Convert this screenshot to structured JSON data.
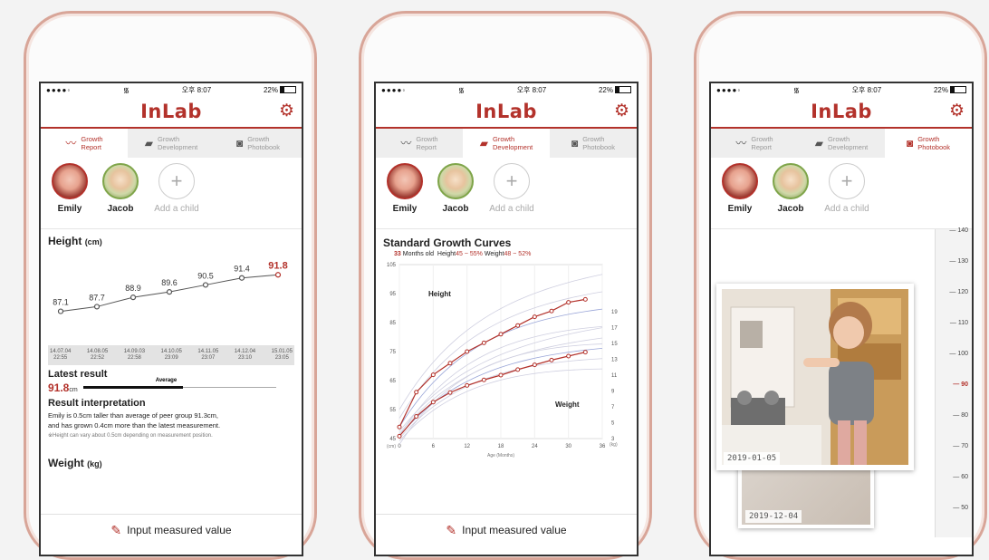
{
  "status": {
    "signal": "●●●●◦",
    "wifi": "wifi-icon",
    "time": "오후 8:07",
    "battery": "22%"
  },
  "app": {
    "logo": "InLab",
    "settings_icon": "gear-icon"
  },
  "tabs": [
    {
      "label1": "Growth",
      "label2": "Report",
      "icon": "trend-icon"
    },
    {
      "label1": "Growth",
      "label2": "Development",
      "icon": "chart-icon"
    },
    {
      "label1": "Growth",
      "label2": "Photobook",
      "icon": "camera-icon"
    }
  ],
  "children": [
    {
      "name": "Emily"
    },
    {
      "name": "Jacob"
    }
  ],
  "add_child": "Add a child",
  "input_button": "Input measured value",
  "report": {
    "height_title": "Height",
    "height_unit": "(cm)",
    "height_values": [
      87.1,
      87.7,
      88.9,
      89.6,
      90.5,
      91.4,
      91.8
    ],
    "height_labels": [
      "87.1",
      "87.7",
      "88.9",
      "89.6",
      "90.5",
      "91.4",
      "91.8"
    ],
    "dates": [
      {
        "d": "14.07.04",
        "t": "22:55"
      },
      {
        "d": "14.08.05",
        "t": "22:52"
      },
      {
        "d": "14.09.03",
        "t": "22:58"
      },
      {
        "d": "14.10.05",
        "t": "23:09"
      },
      {
        "d": "14.11.05",
        "t": "23:07"
      },
      {
        "d": "14.12.04",
        "t": "23:10"
      },
      {
        "d": "15.01.05",
        "t": "23:05"
      }
    ],
    "latest_title": "Latest result",
    "average_label": "Average",
    "latest_value": "91.8",
    "latest_unit": "cm",
    "interp_title": "Result interpretation",
    "interp_text1": "Emily is 0.5cm taller than average of peer group 91.3cm,",
    "interp_text2": "and has grown 0.4cm more than the latest measurement.",
    "interp_note": "※Height can vary about 0.5cm depending on measurement position.",
    "weight_title": "Weight",
    "weight_unit": "(kg)"
  },
  "development": {
    "title": "Standard Growth Curves",
    "age_value": "33",
    "age_text": "Months old",
    "height_label": "Height",
    "height_pct": "45 ~ 55%",
    "weight_label": "Weight",
    "weight_pct": "48 ~ 52%",
    "curve_height_label": "Height",
    "curve_weight_label": "Weight",
    "xlabel": "Age (Months)",
    "y_left_unit": "(cm)",
    "y_right_unit": "(kg)",
    "x_ticks": [
      "0",
      "6",
      "12",
      "18",
      "24",
      "30",
      "36"
    ],
    "y_left_ticks": [
      "105",
      "95",
      "85",
      "75",
      "65",
      "55",
      "45"
    ],
    "y_right_ticks": [
      "19",
      "17",
      "15",
      "13",
      "11",
      "9",
      "7",
      "5",
      "3"
    ]
  },
  "chart_data": {
    "type": "line",
    "title": "Standard Growth Curves",
    "xlabel": "Age (Months)",
    "x_range": [
      0,
      36
    ],
    "y_left_range": [
      45,
      105
    ],
    "y_right_range": [
      3,
      19
    ],
    "series": [
      {
        "x": [
          0,
          3,
          6,
          9,
          12,
          15,
          18,
          21,
          24,
          27,
          30,
          33
        ],
        "y": [
          49,
          61,
          67,
          71,
          75,
          78,
          81,
          84,
          87,
          89,
          92,
          93
        ]
      },
      {
        "x": [
          0,
          3,
          6,
          9,
          12,
          15,
          18,
          21,
          24,
          27,
          30,
          33
        ],
        "y": [
          3.3,
          5.8,
          7.6,
          8.8,
          9.7,
          10.4,
          11,
          11.7,
          12.3,
          12.9,
          13.4,
          13.9
        ]
      }
    ]
  },
  "photobook": {
    "ruler_labels": [
      "140",
      "130",
      "120",
      "110",
      "100",
      "90",
      "80",
      "70",
      "60",
      "50"
    ],
    "photo1_date": "2019-01-05",
    "photo2_date": "2019-12-04"
  }
}
